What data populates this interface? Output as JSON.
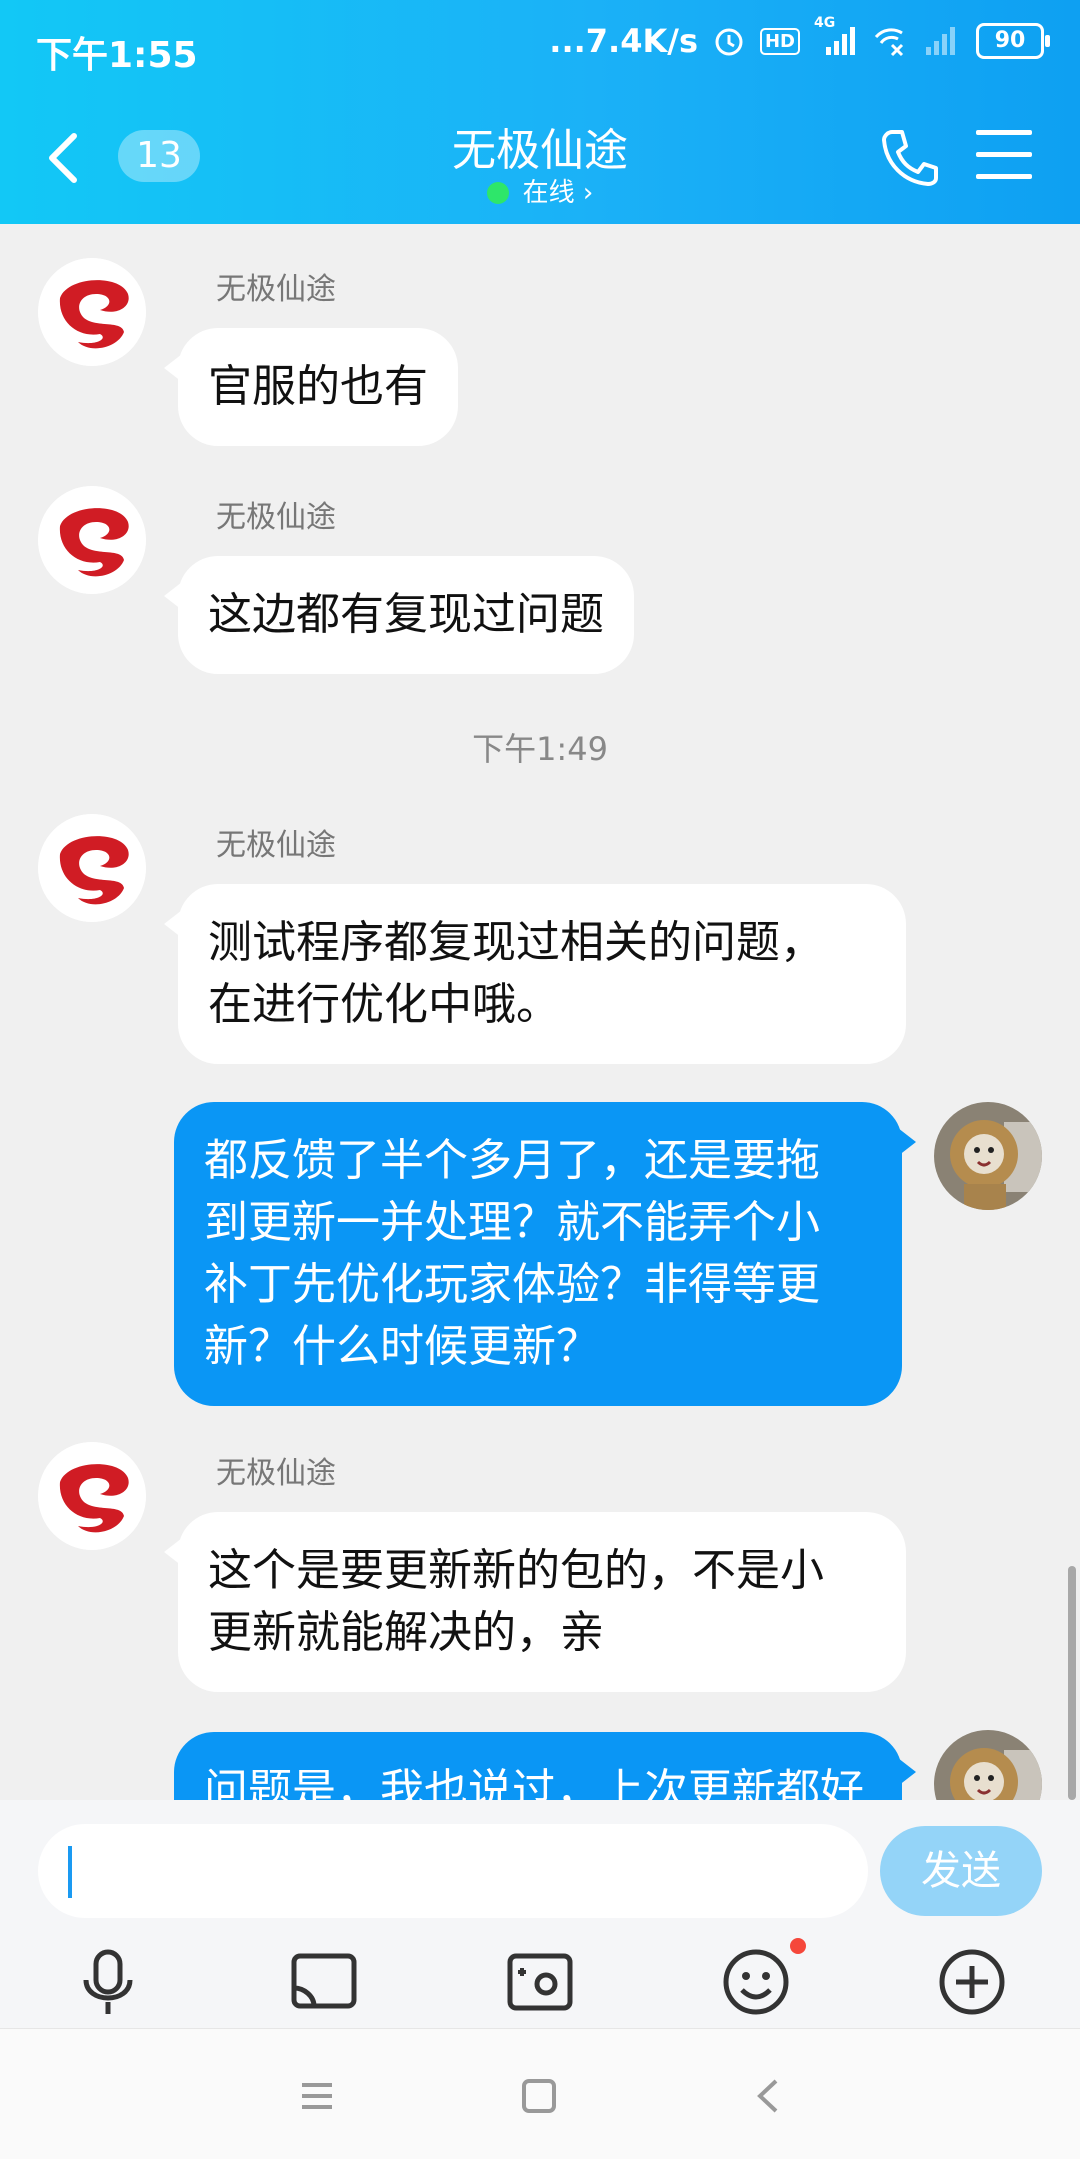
{
  "status_bar": {
    "time": "下午1:55",
    "network_speed": "...7.4K/s",
    "hd_label": "HD",
    "signal_label": "4G",
    "battery": "90"
  },
  "header": {
    "unread_count": "13",
    "title": "无极仙途",
    "status": "在线 ›"
  },
  "messages": [
    {
      "direction": "in",
      "sender": "无极仙途",
      "text": "官服的也有"
    },
    {
      "direction": "in",
      "sender": "无极仙途",
      "text": "这边都有复现过问题"
    },
    {
      "type": "timestamp",
      "text": "下午1:49"
    },
    {
      "direction": "in",
      "sender": "无极仙途",
      "text": "测试程序都复现过相关的问题，\n在进行优化中哦。"
    },
    {
      "direction": "out",
      "text": "都反馈了半个多月了，还是要拖\n到更新一并处理？就不能弄个小\n补丁先优化玩家体验？非得等更\n新？什么时候更新？"
    },
    {
      "direction": "in",
      "sender": "无极仙途",
      "text": "这个是要更新新的包的，不是小\n更新就能解决的，亲"
    },
    {
      "direction": "out",
      "text": "问题是，我也说过，上次更新都好"
    }
  ],
  "input_bar": {
    "placeholder": "",
    "send_label": "发送"
  },
  "toolbar_icons": [
    "microphone-icon",
    "image-icon",
    "camera-icon",
    "emoji-icon",
    "plus-icon"
  ],
  "colors": {
    "header": "#1bb1f7",
    "outgoing_bubble": "#0a96f5",
    "incoming_bubble": "#ffffff",
    "send_button": "#94d4f8",
    "online_dot": "#2ee66a",
    "notification_dot": "#f5473b"
  }
}
